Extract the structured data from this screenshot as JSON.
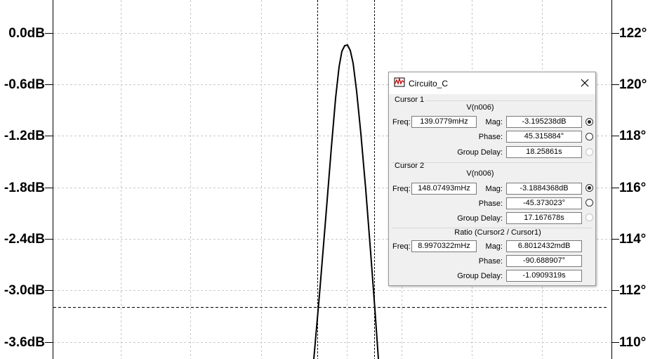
{
  "plot": {
    "left_axis_labels": [
      "0.0dB",
      "-0.6dB",
      "-1.2dB",
      "-1.8dB",
      "-2.4dB",
      "-3.0dB",
      "-3.6dB"
    ],
    "right_axis_labels": [
      "122°",
      "120°",
      "118°",
      "116°",
      "114°",
      "112°",
      "110°"
    ],
    "curve_color": "#000000",
    "grid_color": "#c8c8c8"
  },
  "dialog": {
    "title": "Circuito_C",
    "icon": "probe-waveform-icon",
    "close_icon": "close-x-icon",
    "cursor1": {
      "section": "Cursor 1",
      "trace": "V(n006)",
      "freq_label": "Freq:",
      "freq": "139.0779mHz",
      "mag_label": "Mag:",
      "mag": "-3.195238dB",
      "phase_label": "Phase:",
      "phase": "45.315884°",
      "gd_label": "Group Delay:",
      "gd": "18.25861s"
    },
    "cursor2": {
      "section": "Cursor 2",
      "trace": "V(n006)",
      "freq_label": "Freq:",
      "freq": "148.07493mHz",
      "mag_label": "Mag:",
      "mag": "-3.1884368dB",
      "phase_label": "Phase:",
      "phase": "-45.373023°",
      "gd_label": "Group Delay:",
      "gd": "17.167678s"
    },
    "ratio": {
      "section": "Ratio (Cursor2 / Cursor1)",
      "freq_label": "Freq:",
      "freq": "8.9970322mHz",
      "mag_label": "Mag:",
      "mag": "6.8012432mdB",
      "phase_label": "Phase:",
      "phase": "-90.688907°",
      "gd_label": "Group Delay:",
      "gd": "-1.0909319s"
    }
  }
}
